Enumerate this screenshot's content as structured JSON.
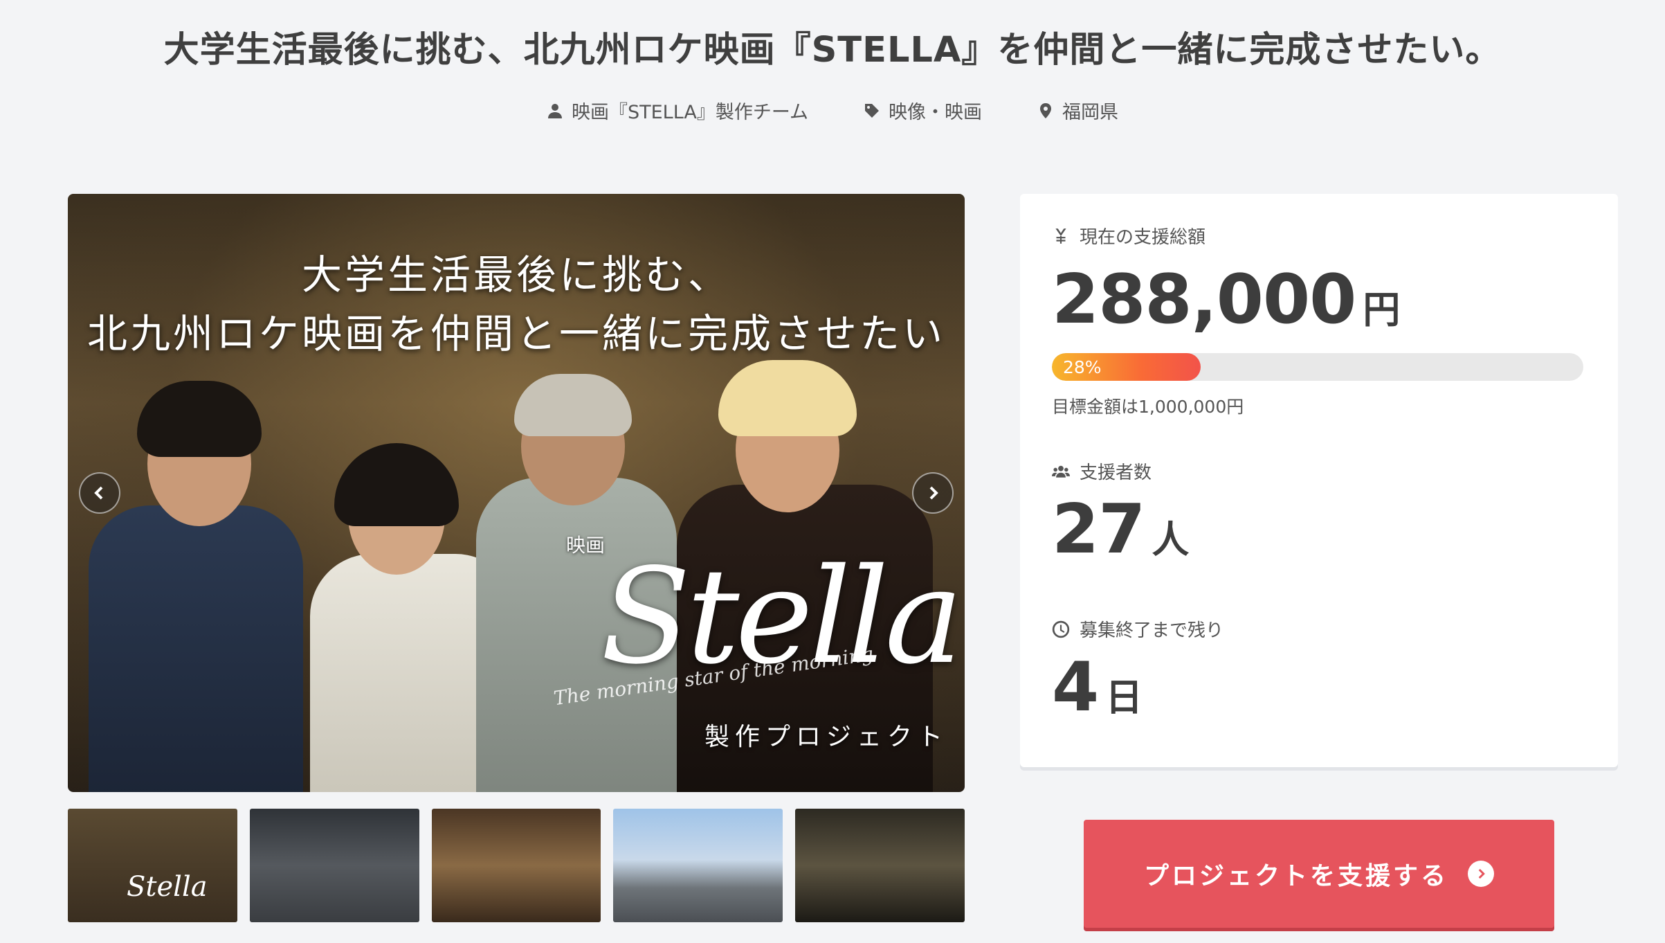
{
  "project": {
    "title": "大学生活最後に挑む、北九州ロケ映画『STELLA』を仲間と一緒に完成させたい。",
    "owner": "映画『STELLA』製作チーム",
    "category": "映像・映画",
    "location": "福岡県"
  },
  "hero": {
    "line1": "大学生活最後に挑む、",
    "line2": "北九州ロケ映画を仲間と一緒に完成させたい",
    "kanji": "映画",
    "logo": "Stella",
    "subtitle": "The morning star of the morning",
    "project_label": "製作プロジェクト"
  },
  "thumbnails": [
    "thumb-1",
    "thumb-2",
    "thumb-3",
    "thumb-4",
    "thumb-5"
  ],
  "stats": {
    "amount_label": "現在の支援総額",
    "amount_value": "288,000",
    "amount_unit": "円",
    "progress_percent": 28,
    "progress_text": "28%",
    "goal_text": "目標金額は1,000,000円",
    "supporters_label": "支援者数",
    "supporters_value": "27",
    "supporters_unit": "人",
    "remaining_label": "募集終了まで残り",
    "remaining_value": "4",
    "remaining_unit": "日"
  },
  "cta": {
    "label": "プロジェクトを支援する"
  },
  "colors": {
    "accent": "#e6545d",
    "progress_start": "#f7b62c",
    "progress_end": "#f2534a"
  }
}
